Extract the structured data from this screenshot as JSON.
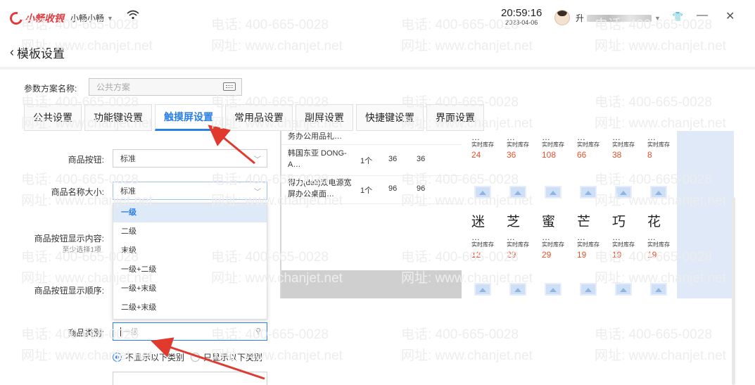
{
  "titlebar": {
    "app_name": "小畅收银",
    "user_menu": "小畅小畅",
    "time": "20:59:16",
    "date": "2023-04-06",
    "account_prefix": "升"
  },
  "page": {
    "title": "模板设置"
  },
  "scheme": {
    "label": "参数方案名称:",
    "placeholder": "公共方案"
  },
  "tabs": [
    "公共设置",
    "功能键设置",
    "触摸屏设置",
    "常用品设置",
    "副屏设置",
    "快捷键设置",
    "界面设置"
  ],
  "active_tab": "触摸屏设置",
  "form": {
    "button_label": "商品按钮:",
    "button_value": "标准",
    "name_size_label": "商品名称大小:",
    "name_size_value": "标准",
    "display_label": "商品按钮显示内容:",
    "display_sub": "至少选择1项",
    "order_label": "商品按钮显示顺序:",
    "category_label": "商品类别:",
    "category_placeholder": "一级",
    "radio1": "不显示以下类别",
    "radio2": "只显示以下类别"
  },
  "dropdown_options": [
    "一级",
    "二级",
    "末级",
    "一级+二级",
    "一级+末级",
    "二级+末级"
  ],
  "dropdown_selected": "一级",
  "preview_list": [
    {
      "name": "务办公用品礼…",
      "qty": "",
      "p1": "",
      "p2": ""
    },
    {
      "name": "韩国东亚 DONG-A…",
      "qty": "1个",
      "p1": "36",
      "p2": "36"
    },
    {
      "name": "得力(deli)双电源宽屏办公桌面…",
      "qty": "1个",
      "p1": "96",
      "p2": "96"
    }
  ],
  "preview_grid": {
    "row1": {
      "label": "实时库存",
      "nums": [
        "24",
        "36",
        "108",
        "66",
        "38",
        "8"
      ]
    },
    "chars": [
      "迷",
      "芝",
      "蜜",
      "芒",
      "巧",
      "花"
    ],
    "row2": {
      "label": "实时库存",
      "nums": [
        "12",
        "29",
        "29",
        "19",
        "19",
        "19"
      ]
    },
    "dots": "…"
  },
  "watermark": {
    "phone": "电话: 400-665-0028",
    "site": "网址: www.chanjet.net"
  },
  "colors": {
    "accent": "#2b7fe6",
    "brand": "#e4393c",
    "stock": "#e8522b"
  }
}
